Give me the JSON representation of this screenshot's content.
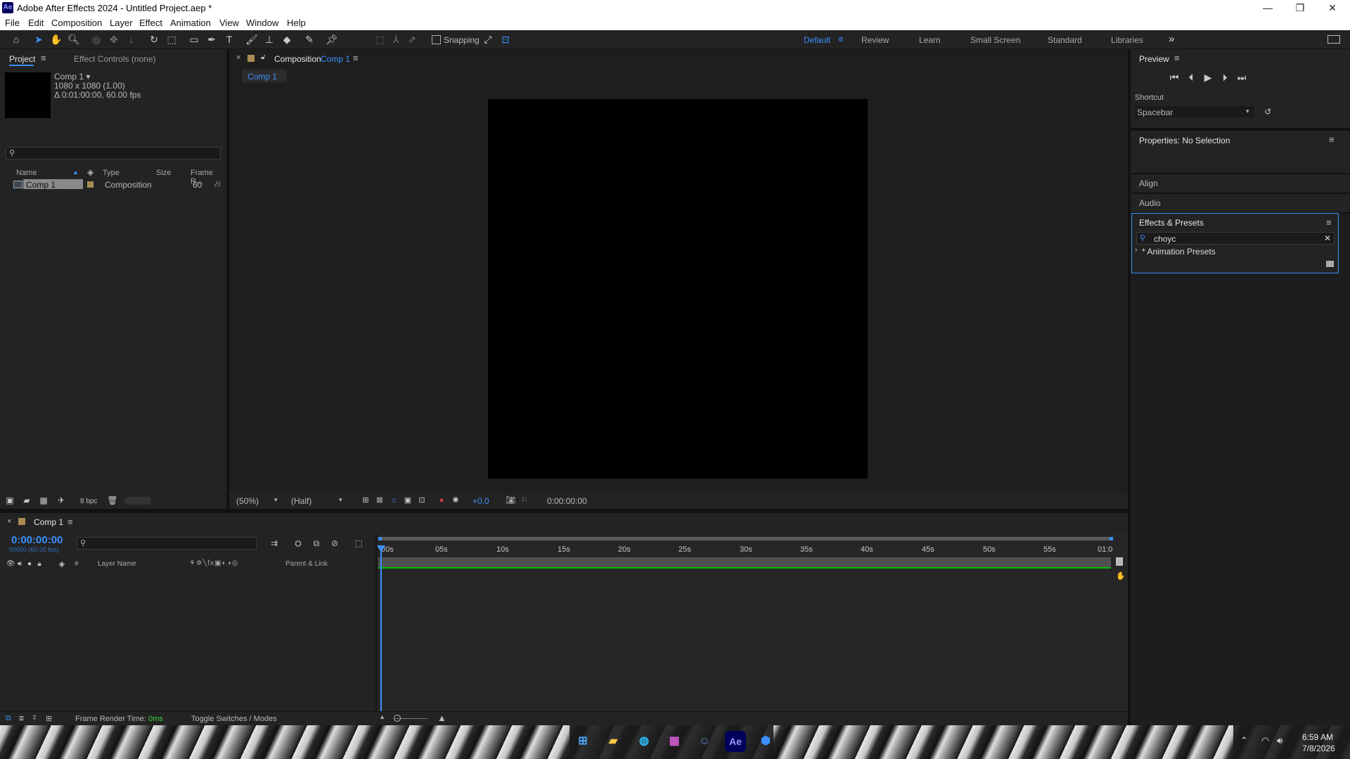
{
  "app": {
    "badge": "Ae",
    "title": "Adobe After Effects 2024 - Untitled Project.aep *"
  },
  "window_controls": {
    "minimize": "—",
    "maximize": "❐",
    "close": "✕"
  },
  "menu": [
    "File",
    "Edit",
    "Composition",
    "Layer",
    "Effect",
    "Animation",
    "View",
    "Window",
    "Help"
  ],
  "toolbar": {
    "snapping_label": "Snapping"
  },
  "workspaces": [
    "Default",
    "Review",
    "Learn",
    "Small Screen",
    "Standard",
    "Libraries"
  ],
  "workspace_active": "Default",
  "workspace_overflow": "»",
  "project": {
    "tab_project": "Project",
    "tab_effect_controls": "Effect Controls (none)",
    "item_name": "Comp 1 ▾",
    "item_size": "1080 x 1080 (1.00)",
    "item_duration": "Δ 0:01:00:00, 60.00 fps",
    "columns": {
      "name": "Name",
      "type": "Type",
      "size": "Size",
      "frame_rate": "Frame R..."
    },
    "rows": [
      {
        "name": "Comp 1",
        "type": "Composition",
        "size": "",
        "frame_rate": "60"
      }
    ],
    "bpc": "8 bpc"
  },
  "composition": {
    "tab_prefix": "Composition",
    "tab_name": "Comp 1",
    "subtab": "Comp 1",
    "zoom": "(50%)",
    "resolution": "(Half)",
    "exposure": "+0.0",
    "timecode": "0:00:00:00"
  },
  "preview": {
    "title": "Preview",
    "shortcut_label": "Shortcut",
    "shortcut_value": "Spacebar"
  },
  "properties": {
    "title": "Properties: No Selection"
  },
  "align": {
    "title": "Align"
  },
  "audio": {
    "title": "Audio"
  },
  "effects_presets": {
    "title": "Effects & Presets",
    "search_value": "choyc",
    "tree_item": "* Animation Presets"
  },
  "timeline": {
    "tab": "Comp 1",
    "timecode": "0:00:00:00",
    "frame_info": "00000 (60.00 fps)",
    "col_layer_name": "Layer Name",
    "col_parent": "Parent & Link",
    "col_hash": "#",
    "ruler": [
      "00s",
      "05s",
      "10s",
      "15s",
      "20s",
      "25s",
      "30s",
      "35s",
      "40s",
      "45s",
      "50s",
      "55s",
      "01:0"
    ]
  },
  "status": {
    "frame_render_label": "Frame Render Time:",
    "frame_render_value": "0ms",
    "toggle": "Toggle Switches / Modes"
  },
  "taskbar": {
    "time": "6:59 AM",
    "date": "7/8/2026",
    "ae_badge": "Ae"
  },
  "colors": {
    "accent": "#3a90ff",
    "panel": "#232323",
    "separator": "#121212",
    "comp_bg": "#000000",
    "timeline_bar": "#00c000"
  }
}
